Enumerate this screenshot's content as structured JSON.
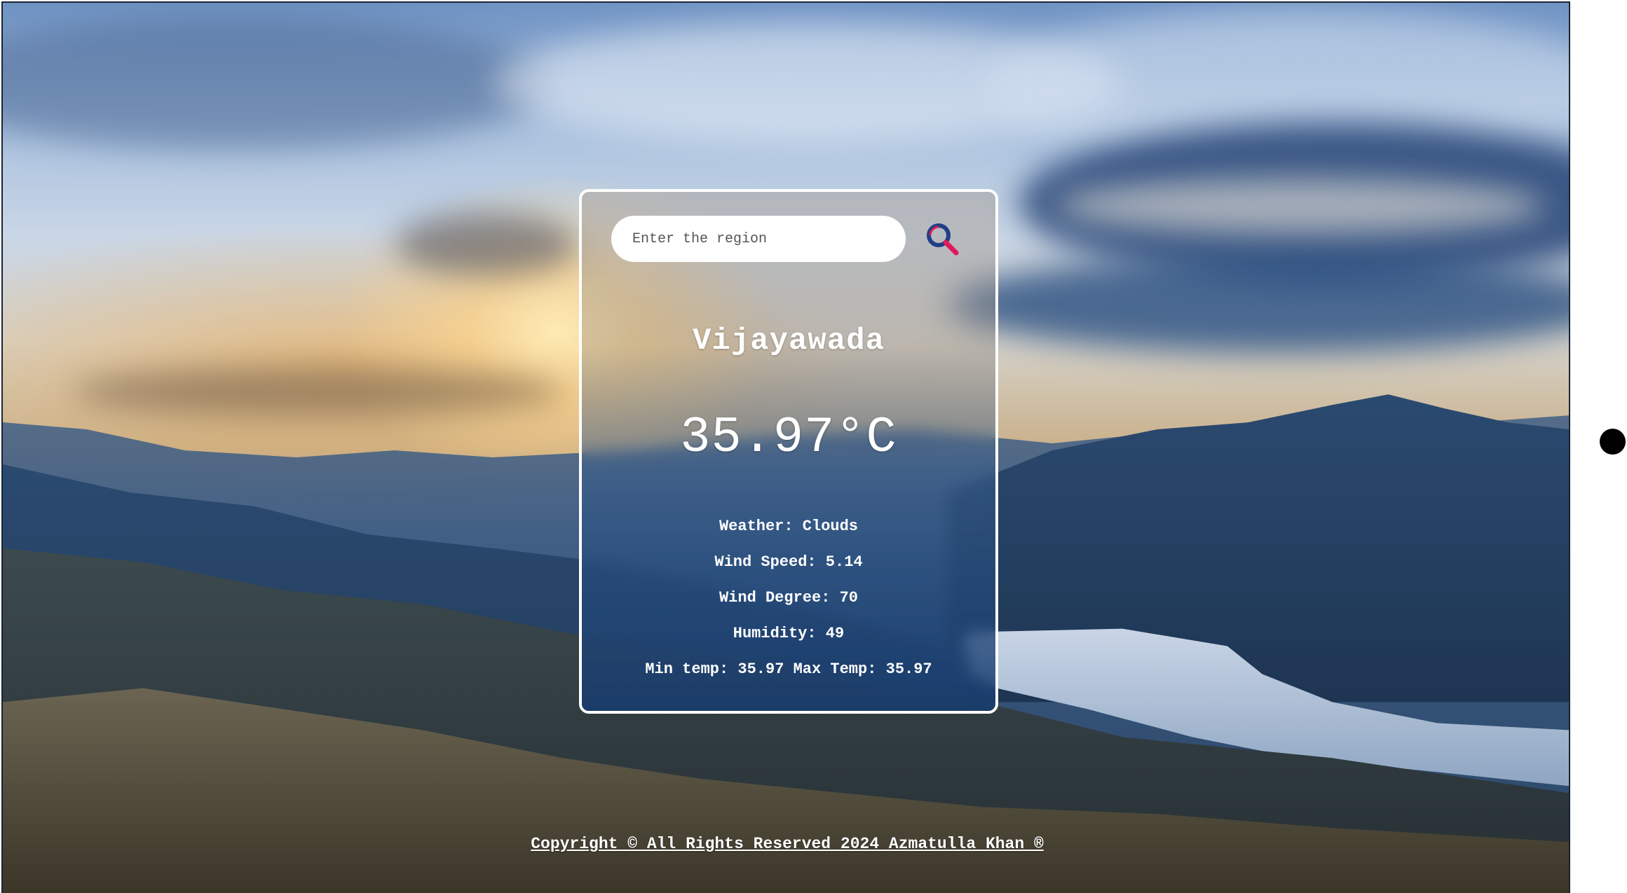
{
  "search": {
    "placeholder": "Enter the region",
    "icon": "search-icon",
    "icon_colors": {
      "lens": "#1f3f86",
      "handle": "#e0195a"
    }
  },
  "weather": {
    "city": "Vijayawada",
    "temperature": "35.97°C",
    "condition": "Weather: Clouds",
    "wind_speed": "Wind Speed: 5.14",
    "wind_degree": "Wind Degree: 70",
    "humidity": "Humidity: 49",
    "min_max": "Min temp: 35.97 Max Temp: 35.97"
  },
  "footer": {
    "copyright": "Copyright © All Rights Reserved 2024 Azmatulla Khan ®"
  },
  "colors": {
    "card_border": "#ffffff",
    "text": "#ffffff"
  }
}
